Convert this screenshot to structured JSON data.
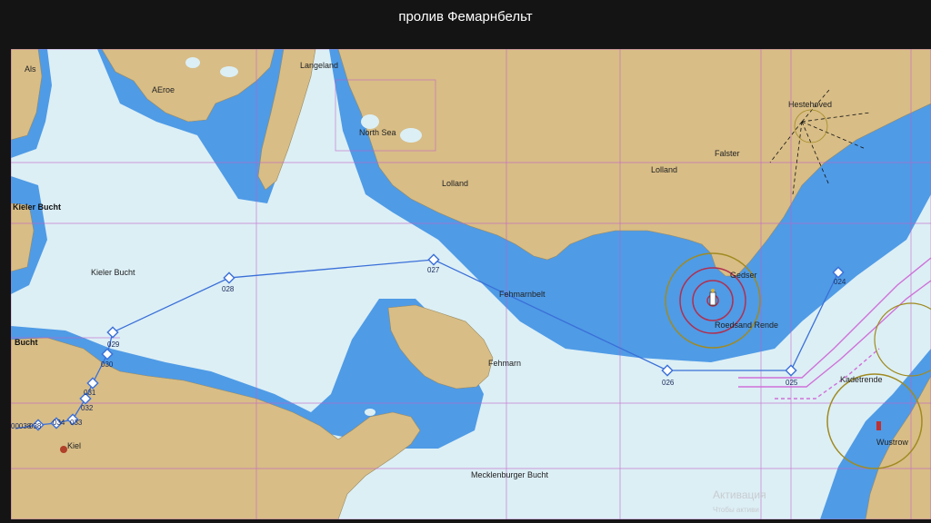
{
  "title": "пролив Фемарнбельт",
  "map": {
    "colors": {
      "land": "#d8bd86",
      "shallow": "#4f9be6",
      "deep": "#dceff5",
      "route": "#3a6fd8",
      "chart_limits": "#c060c8",
      "traffic_lanes": "#d070d8",
      "light_ring": "#a08a20",
      "light_red": "#b03050"
    },
    "places": {
      "als": "Als",
      "aeroe": "AEroe",
      "langeland": "Langeland",
      "north_sea": "North Sea",
      "lolland_west": "Lolland",
      "lolland_east": "Lolland",
      "falster": "Falster",
      "hesternaes": "Hestehoved",
      "kieler_bucht_bold": "Kieler Bucht",
      "kieler_bucht": "Kieler Bucht",
      "bucht_left": "Bucht",
      "fehmarnbelt": "Fehmarnbelt",
      "fehmarn": "Fehmarn",
      "gedser": "Gedser",
      "roedsand": "Roedsand Rende",
      "kadetrende": "Kadetrende",
      "wustrow": "Wustrow",
      "mecklenburger": "Mecklenburger Bucht",
      "kiel": "Kiel"
    },
    "waypoints": [
      "024",
      "025",
      "026",
      "027",
      "028",
      "029",
      "030",
      "031",
      "032",
      "033",
      "034",
      "038"
    ],
    "left_edge_labels": [
      "00038",
      "036"
    ],
    "watermark": {
      "line1": "Активация",
      "line2": "Чтобы активи"
    }
  }
}
